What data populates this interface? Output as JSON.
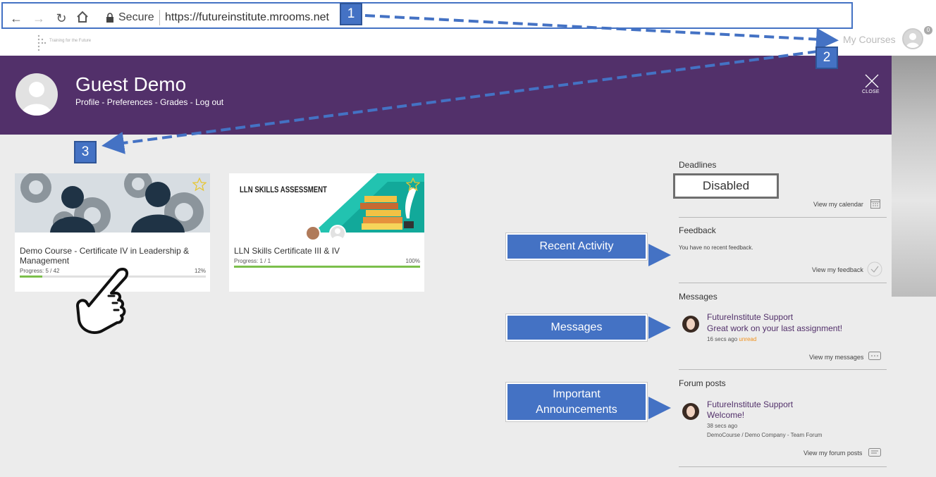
{
  "browser": {
    "secure_label": "Secure",
    "url": "https://futureinstitute.mrooms.net"
  },
  "site": {
    "tagline": "Training for the Future",
    "my_courses_label": "My Courses",
    "notification_count": "0"
  },
  "user": {
    "name": "Guest Demo",
    "links": [
      "Profile",
      "Preferences",
      "Grades",
      "Log out"
    ],
    "separator": " - ",
    "close_label": "CLOSE"
  },
  "courses": [
    {
      "title_line1": "Demo Course - Certificate IV in Leadership &",
      "title_line2": "Management",
      "progress_label": "Progress: 5 / 42",
      "progress_percent_label": "12%",
      "progress_fraction": 0.12
    },
    {
      "banner_text": "LLN SKILLS ASSESSMENT",
      "title_line1": "LLN Skills Certificate III & IV",
      "progress_label": "Progress: 1 / 1",
      "progress_percent_label": "100%",
      "progress_fraction": 1.0
    }
  ],
  "sidebar": {
    "deadlines": {
      "title": "Deadlines",
      "status": "Disabled",
      "link": "View my calendar"
    },
    "feedback": {
      "title": "Feedback",
      "note": "You have no recent feedback.",
      "link": "View my feedback"
    },
    "messages": {
      "title": "Messages",
      "from": "FutureInstitute Support",
      "text": "Great work on your last assignment!",
      "time": "16 secs ago",
      "unread": "unread",
      "link": "View my messages"
    },
    "forum": {
      "title": "Forum posts",
      "from": "FutureInstitute Support",
      "text": "Welcome!",
      "time": "38 secs ago",
      "context": "DemoCourse / Demo Company - Team Forum",
      "link": "View my forum posts"
    }
  },
  "annotations": {
    "badges": [
      "1",
      "2",
      "3"
    ],
    "callouts": {
      "recent_activity": "Recent Activity",
      "messages": "Messages",
      "important_line1": "Important",
      "important_line2": "Announcements"
    },
    "accent_color": "#4472c4",
    "banner_color": "#52306a",
    "progress_color": "#7bbf4b"
  }
}
